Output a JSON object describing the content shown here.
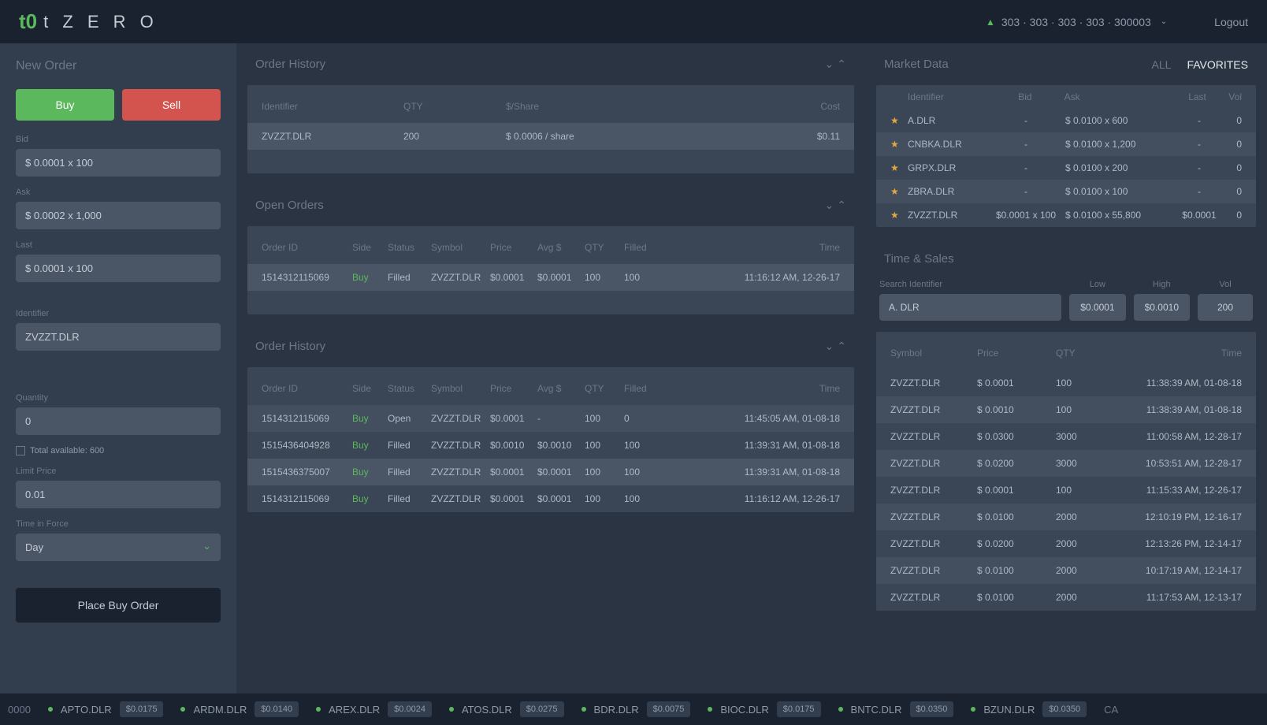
{
  "header": {
    "brand": "t Z E R O",
    "account": "303 · 303 · 303 · 303 · 300003",
    "logout": "Logout"
  },
  "newOrder": {
    "title": "New Order",
    "buy": "Buy",
    "sell": "Sell",
    "bidLabel": "Bid",
    "bidValue": "$ 0.0001 x 100",
    "askLabel": "Ask",
    "askValue": "$ 0.0002 x 1,000",
    "lastLabel": "Last",
    "lastValue": "$ 0.0001 x 100",
    "identifierLabel": "Identifier",
    "identifierValue": "ZVZZT.DLR",
    "quantityLabel": "Quantity",
    "quantityValue": "0",
    "totalAvailable": "Total available: 600",
    "limitPriceLabel": "Limit Price",
    "limitPriceValue": "0.01",
    "tifLabel": "Time in Force",
    "tifValue": "Day",
    "placeOrder": "Place Buy Order"
  },
  "orderSummary": {
    "title": "Order History",
    "cols": {
      "identifier": "Identifier",
      "qty": "QTY",
      "share": "$/Share",
      "cost": "Cost"
    },
    "row": {
      "identifier": "ZVZZT.DLR",
      "qty": "200",
      "share": "$ 0.0006 / share",
      "cost": "$0.11"
    }
  },
  "openOrders": {
    "title": "Open Orders",
    "cols": {
      "orderId": "Order ID",
      "side": "Side",
      "status": "Status",
      "symbol": "Symbol",
      "price": "Price",
      "avg": "Avg $",
      "qty": "QTY",
      "filled": "Filled",
      "time": "Time"
    },
    "rows": [
      {
        "orderId": "1514312115069",
        "side": "Buy",
        "status": "Filled",
        "symbol": "ZVZZT.DLR",
        "price": "$0.0001",
        "avg": "$0.0001",
        "qty": "100",
        "filled": "100",
        "time": "11:16:12 AM, 12-26-17"
      }
    ]
  },
  "orderHistory": {
    "title": "Order History",
    "cols": {
      "orderId": "Order ID",
      "side": "Side",
      "status": "Status",
      "symbol": "Symbol",
      "price": "Price",
      "avg": "Avg $",
      "qty": "QTY",
      "filled": "Filled",
      "time": "Time"
    },
    "rows": [
      {
        "orderId": "1514312115069",
        "side": "Buy",
        "status": "Open",
        "symbol": "ZVZZT.DLR",
        "price": "$0.0001",
        "avg": "-",
        "qty": "100",
        "filled": "0",
        "time": "11:45:05 AM, 01-08-18"
      },
      {
        "orderId": "1515436404928",
        "side": "Buy",
        "status": "Filled",
        "symbol": "ZVZZT.DLR",
        "price": "$0.0010",
        "avg": "$0.0010",
        "qty": "100",
        "filled": "100",
        "time": "11:39:31 AM, 01-08-18"
      },
      {
        "orderId": "1515436375007",
        "side": "Buy",
        "status": "Filled",
        "symbol": "ZVZZT.DLR",
        "price": "$0.0001",
        "avg": "$0.0001",
        "qty": "100",
        "filled": "100",
        "time": "11:39:31 AM, 01-08-18"
      },
      {
        "orderId": "1514312115069",
        "side": "Buy",
        "status": "Filled",
        "symbol": "ZVZZT.DLR",
        "price": "$0.0001",
        "avg": "$0.0001",
        "qty": "100",
        "filled": "100",
        "time": "11:16:12 AM, 12-26-17"
      }
    ]
  },
  "marketData": {
    "title": "Market Data",
    "tabs": {
      "all": "ALL",
      "fav": "FAVORITES"
    },
    "cols": {
      "identifier": "Identifier",
      "bid": "Bid",
      "ask": "Ask",
      "last": "Last",
      "vol": "Vol"
    },
    "rows": [
      {
        "identifier": "A.DLR",
        "bid": "-",
        "ask": "$ 0.0100 x 600",
        "last": "-",
        "vol": "0"
      },
      {
        "identifier": "CNBKA.DLR",
        "bid": "-",
        "ask": "$ 0.0100 x 1,200",
        "last": "-",
        "vol": "0"
      },
      {
        "identifier": "GRPX.DLR",
        "bid": "-",
        "ask": "$ 0.0100 x 200",
        "last": "-",
        "vol": "0"
      },
      {
        "identifier": "ZBRA.DLR",
        "bid": "-",
        "ask": "$ 0.0100 x 100",
        "last": "-",
        "vol": "0"
      },
      {
        "identifier": "ZVZZT.DLR",
        "bid": "$0.0001 x 100",
        "ask": "$ 0.0100 x 55,800",
        "last": "$0.0001",
        "vol": "0"
      }
    ]
  },
  "timeSales": {
    "title": "Time & Sales",
    "searchLabel": "Search Identifier",
    "searchValue": "A. DLR",
    "lowLabel": "Low",
    "lowValue": "$0.0001",
    "highLabel": "High",
    "highValue": "$0.0010",
    "volLabel": "Vol",
    "volValue": "200",
    "cols": {
      "symbol": "Symbol",
      "price": "Price",
      "qty": "QTY",
      "time": "Time"
    },
    "rows": [
      {
        "symbol": "ZVZZT.DLR",
        "price": "$ 0.0001",
        "qty": "100",
        "time": "11:38:39 AM, 01-08-18"
      },
      {
        "symbol": "ZVZZT.DLR",
        "price": "$ 0.0010",
        "qty": "100",
        "time": "11:38:39 AM, 01-08-18"
      },
      {
        "symbol": "ZVZZT.DLR",
        "price": "$ 0.0300",
        "qty": "3000",
        "time": "11:00:58 AM, 12-28-17"
      },
      {
        "symbol": "ZVZZT.DLR",
        "price": "$ 0.0200",
        "qty": "3000",
        "time": "10:53:51 AM, 12-28-17"
      },
      {
        "symbol": "ZVZZT.DLR",
        "price": "$ 0.0001",
        "qty": "100",
        "time": "11:15:33 AM, 12-26-17"
      },
      {
        "symbol": "ZVZZT.DLR",
        "price": "$ 0.0100",
        "qty": "2000",
        "time": "12:10:19 PM, 12-16-17"
      },
      {
        "symbol": "ZVZZT.DLR",
        "price": "$ 0.0200",
        "qty": "2000",
        "time": "12:13:26 PM, 12-14-17"
      },
      {
        "symbol": "ZVZZT.DLR",
        "price": "$ 0.0100",
        "qty": "2000",
        "time": "10:17:19 AM, 12-14-17"
      },
      {
        "symbol": "ZVZZT.DLR",
        "price": "$ 0.0100",
        "qty": "2000",
        "time": "11:17:53 AM, 12-13-17"
      }
    ]
  },
  "ticker": [
    {
      "symbol": "APTO.DLR",
      "price": "$0.0175"
    },
    {
      "symbol": "ARDM.DLR",
      "price": "$0.0140"
    },
    {
      "symbol": "AREX.DLR",
      "price": "$0.0024"
    },
    {
      "symbol": "ATOS.DLR",
      "price": "$0.0275"
    },
    {
      "symbol": "BDR.DLR",
      "price": "$0.0075"
    },
    {
      "symbol": "BIOC.DLR",
      "price": "$0.0175"
    },
    {
      "symbol": "BNTC.DLR",
      "price": "$0.0350"
    },
    {
      "symbol": "BZUN.DLR",
      "price": "$0.0350"
    }
  ]
}
